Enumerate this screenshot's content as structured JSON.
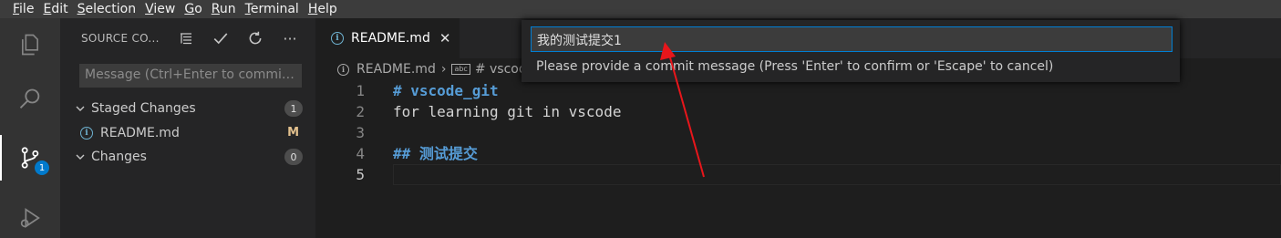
{
  "menu": [
    "File",
    "Edit",
    "Selection",
    "View",
    "Go",
    "Run",
    "Terminal",
    "Help"
  ],
  "activity": {
    "scm_badge": "1"
  },
  "sidebar": {
    "title": "SOURCE CO...",
    "message_placeholder": "Message (Ctrl+Enter to commit...",
    "staged_label": "Staged Changes",
    "staged_count": "1",
    "staged_file": "README.md",
    "staged_file_status": "M",
    "changes_label": "Changes",
    "changes_count": "0"
  },
  "editor": {
    "tab_label": "README.md",
    "breadcrumb_file": "README.md",
    "breadcrumb_symbol": "# vscode_git",
    "lines": [
      {
        "num": "1",
        "text": "# vscode_git"
      },
      {
        "num": "2",
        "text": "for learning git in vscode"
      },
      {
        "num": "3",
        "text": ""
      },
      {
        "num": "4",
        "text": "## 测试提交"
      },
      {
        "num": "5",
        "text": ""
      }
    ]
  },
  "quick_input": {
    "value": "我的测试提交1",
    "message": "Please provide a commit message (Press 'Enter' to confirm or 'Escape' to cancel)"
  },
  "colors": {
    "accent": "#007acc",
    "heading": "#569cd6",
    "annotation_arrow": "#e8161b"
  }
}
